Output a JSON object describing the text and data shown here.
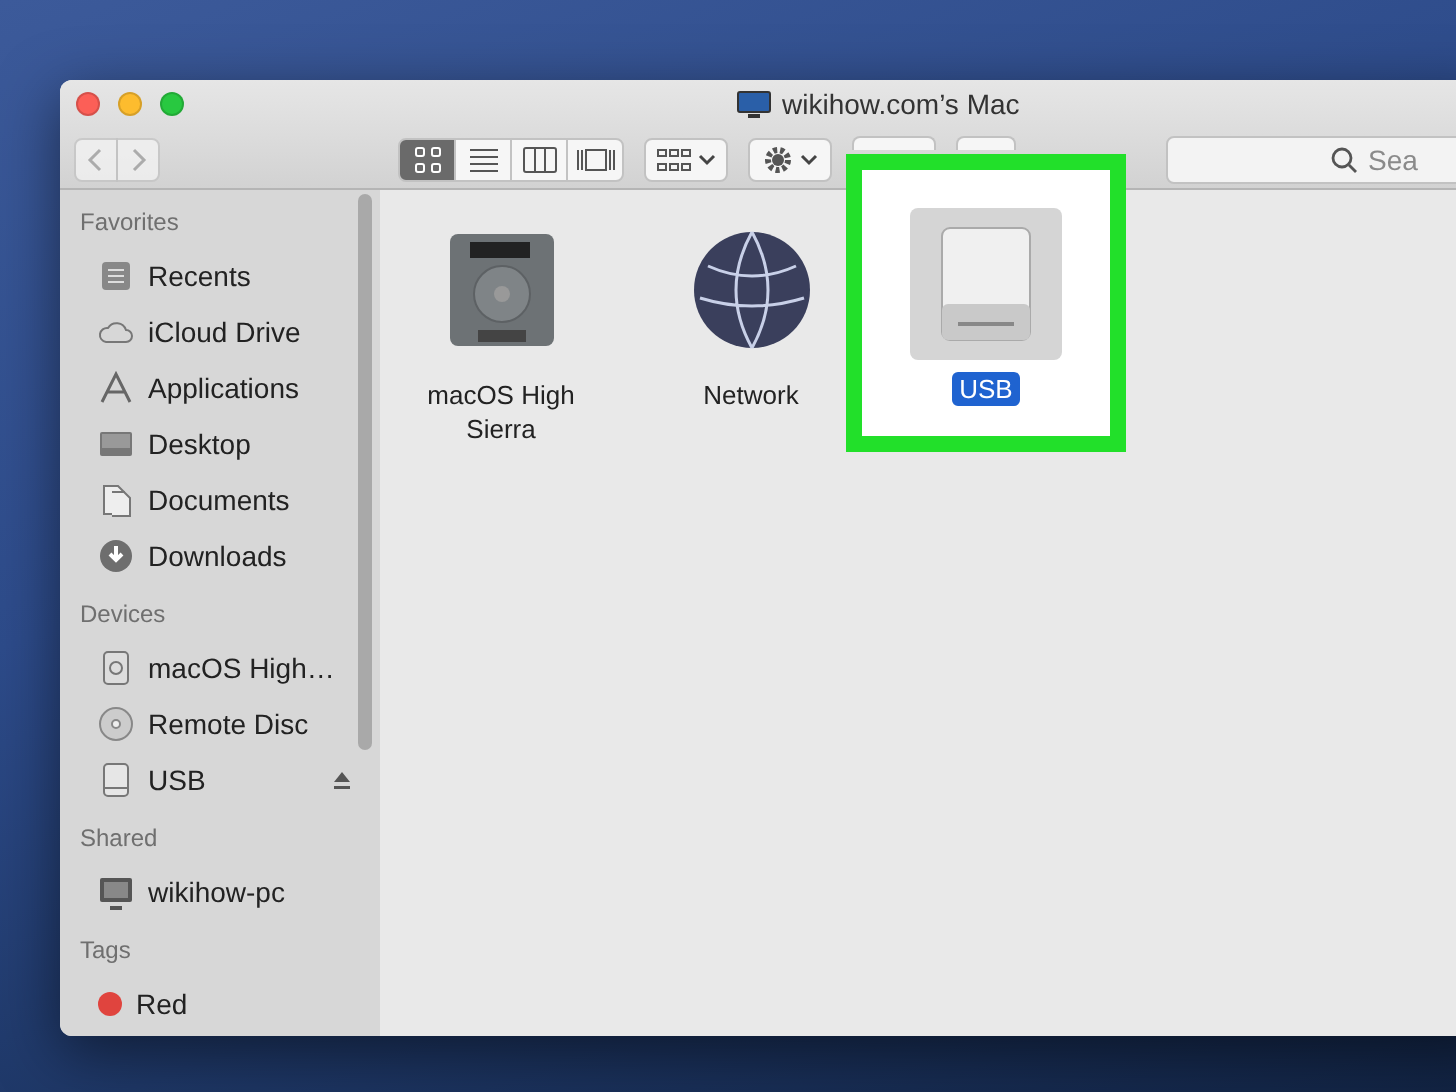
{
  "window": {
    "title": "wikihow.com’s Mac"
  },
  "toolbar": {
    "back_disabled": true,
    "forward_disabled": true,
    "view_modes": [
      {
        "kind": "icons",
        "selected": true
      },
      {
        "kind": "list",
        "selected": false
      },
      {
        "kind": "columns",
        "selected": false
      },
      {
        "kind": "gallery",
        "selected": false
      }
    ],
    "search": {
      "placeholder": "Sea"
    }
  },
  "sidebar": {
    "sections": [
      {
        "title": "Favorites",
        "items": [
          {
            "kind": "recents",
            "label": "Recents",
            "eject": false
          },
          {
            "kind": "cloud",
            "label": "iCloud Drive",
            "eject": false
          },
          {
            "kind": "applications",
            "label": "Applications",
            "eject": false
          },
          {
            "kind": "desktop",
            "label": "Desktop",
            "eject": false
          },
          {
            "kind": "documents",
            "label": "Documents",
            "eject": false
          },
          {
            "kind": "downloads",
            "label": "Downloads",
            "eject": false
          }
        ]
      },
      {
        "title": "Devices",
        "items": [
          {
            "kind": "disk",
            "label": "macOS High…",
            "eject": false
          },
          {
            "kind": "disc",
            "label": "Remote Disc",
            "eject": false
          },
          {
            "kind": "usb",
            "label": "USB",
            "eject": true
          }
        ]
      },
      {
        "title": "Shared",
        "items": [
          {
            "kind": "computer",
            "label": "wikihow-pc",
            "eject": false
          }
        ]
      },
      {
        "title": "Tags",
        "items": [
          {
            "kind": "tag",
            "label": "Red",
            "eject": false,
            "color": "#e0443e"
          }
        ]
      }
    ]
  },
  "files": [
    {
      "kind": "harddisk",
      "label": "macOS High Sierra",
      "selected": false,
      "highlighted": false
    },
    {
      "kind": "network",
      "label": "Network",
      "selected": false,
      "highlighted": false
    },
    {
      "kind": "usb",
      "label": "USB",
      "selected": true,
      "highlighted": true
    }
  ]
}
